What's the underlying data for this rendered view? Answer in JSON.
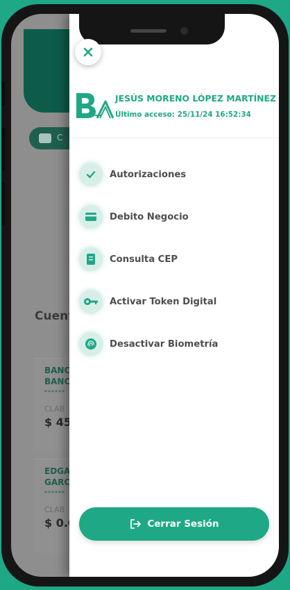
{
  "background_app": {
    "chip_label": "C",
    "section_title": "Cuent",
    "accounts": [
      {
        "line1": "BANC",
        "line2": "BANC",
        "masked": "******",
        "label": "CLAB",
        "amount": "$ 45"
      },
      {
        "line1": "EDGA",
        "line2": "GARC",
        "masked": "******",
        "label": "CLAB",
        "amount": "$ 0.0"
      }
    ]
  },
  "drawer": {
    "user_name": "JESÚS MORENO LÓPEZ MARTÍNEZ",
    "last_access": "Último acceso: 25/11/24 16:52:34",
    "menu": [
      {
        "label": "Autorizaciones",
        "icon": "check-icon"
      },
      {
        "label": "Debito Negocio",
        "icon": "card-icon"
      },
      {
        "label": "Consulta CEP",
        "icon": "document-icon"
      },
      {
        "label": "Activar Token Digital",
        "icon": "key-icon"
      },
      {
        "label": "Desactivar Biometría",
        "icon": "fingerprint-icon"
      }
    ],
    "logout_label": "Cerrar Sesión"
  },
  "colors": {
    "accent": "#1fa886",
    "icon_bg": "#d8efe9",
    "menu_text": "#4d4d4d"
  }
}
